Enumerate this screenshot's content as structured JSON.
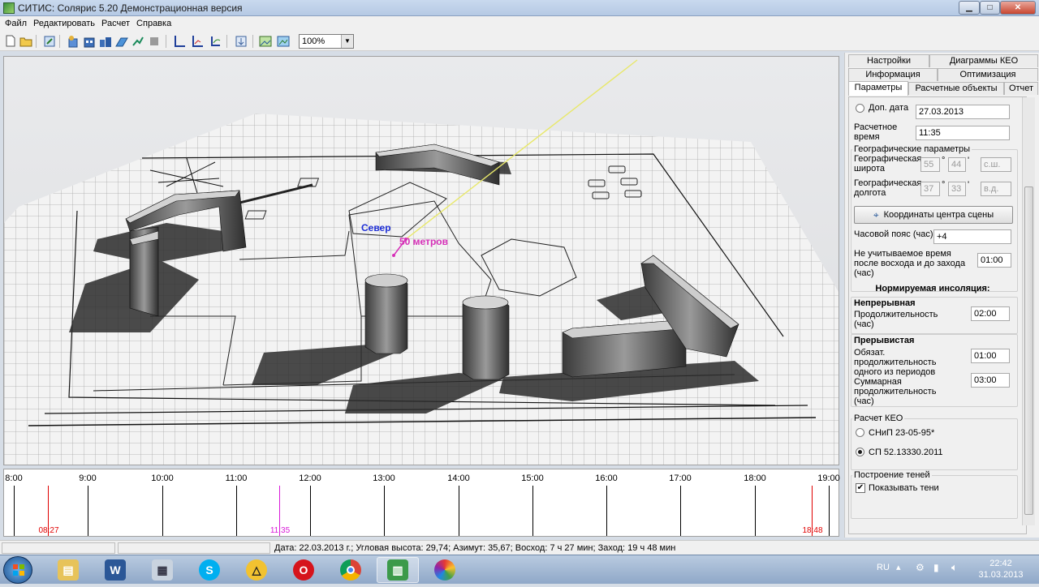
{
  "window": {
    "title": "СИТИС: Солярис 5.20 Демонстрационная версия",
    "min": "▁",
    "max": "□",
    "close": "✕"
  },
  "menu": [
    "Файл",
    "Редактировать",
    "Расчет",
    "Справка"
  ],
  "toolbar": {
    "zoom": "100%"
  },
  "scene": {
    "north_label": "Север",
    "scale_label": "50 метров",
    "north_color": "#1f2fd6",
    "scale_color": "#d62fb8",
    "sun_ray_color": "#e8e86a"
  },
  "timeline": {
    "hours": [
      "8:00",
      "9:00",
      "10:00",
      "11:00",
      "12:00",
      "13:00",
      "14:00",
      "15:00",
      "16:00",
      "17:00",
      "18:00",
      "19:00"
    ],
    "sunrise": {
      "label": "08:27",
      "color": "#e00000"
    },
    "current": {
      "label": "11:35",
      "color": "#d81ad8"
    },
    "sunset": {
      "label": "18:48",
      "color": "#e00000"
    }
  },
  "status": "Дата: 22.03.2013 г.; Угловая высота: 29,74; Азимут: 35,67; Восход: 7 ч 27 мин; Заход: 19 ч 48 мин",
  "panel": {
    "tabs_row1": [
      "Настройки",
      "Диаграммы КЕО"
    ],
    "tabs_row2": [
      "Информация",
      "Оптимизация"
    ],
    "tabs_row3": [
      "Параметры",
      "Расчетные объекты",
      "Отчет"
    ],
    "add_date_label": "Доп. дата",
    "add_date_value": "27.03.2013",
    "calc_time_label": "Расчетное время",
    "calc_time_value": "11:35",
    "geo_group": "Географические параметры",
    "lat_label": "Географическая широта",
    "lat_deg": "55",
    "lat_min": "44",
    "lat_dir": "с.ш.",
    "lon_label": "Географическая долгота",
    "lon_deg": "37",
    "lon_min": "33",
    "lon_dir": "в.д.",
    "coords_button": "Координаты центра сцены",
    "tz_label": "Часовой пояс (час)",
    "tz_value": "+4",
    "ignore_label": "Не учитываемое время после восхода и до захода (час)",
    "ignore_value": "01:00",
    "norm_title": "Нормируемая инсоляция:",
    "cont_title": "Непрерывная",
    "cont_label": "Продолжительность (час)",
    "cont_value": "02:00",
    "inter_title": "Прерывистая",
    "inter_label1": "Обязат. продолжительность одного из периодов",
    "inter_value1": "01:00",
    "inter_label2": "Суммарная продолжительность (час)",
    "inter_value2": "03:00",
    "keo_group": "Расчет КЕО",
    "keo_opt1": "СНиП 23-05-95*",
    "keo_opt2": "СП 52.13330.2011",
    "shadow_group": "Построение теней",
    "shadow_check": "Показывать тени"
  },
  "taskbar": {
    "lang": "RU",
    "time": "22:42",
    "date": "31.03.2013"
  }
}
